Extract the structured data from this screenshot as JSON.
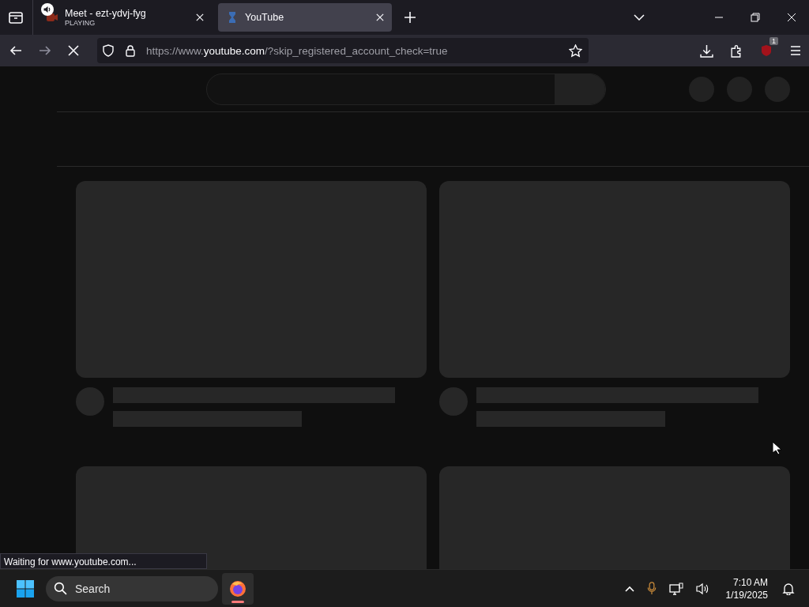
{
  "tabs": [
    {
      "title": "Meet - ezt-ydvj-fyg",
      "subtitle": "PLAYING",
      "audio": true,
      "selected": false
    },
    {
      "title": "YouTube",
      "selected": true
    }
  ],
  "address_bar": {
    "url_prefix": "https://www.",
    "url_domain": "youtube.com",
    "url_rest": "/?skip_registered_account_check=true"
  },
  "extension_badge": "1",
  "feed": [
    {
      "kind": "placeholder"
    },
    {
      "kind": "placeholder"
    },
    {
      "kind": "thumbnail"
    },
    {
      "kind": "thumbnail"
    }
  ],
  "status_text": "Waiting for www.youtube.com...",
  "taskbar": {
    "search_placeholder": "Search",
    "apps": [
      {
        "active": true
      }
    ],
    "time": "7:10 AM",
    "date": "1/19/2025"
  }
}
